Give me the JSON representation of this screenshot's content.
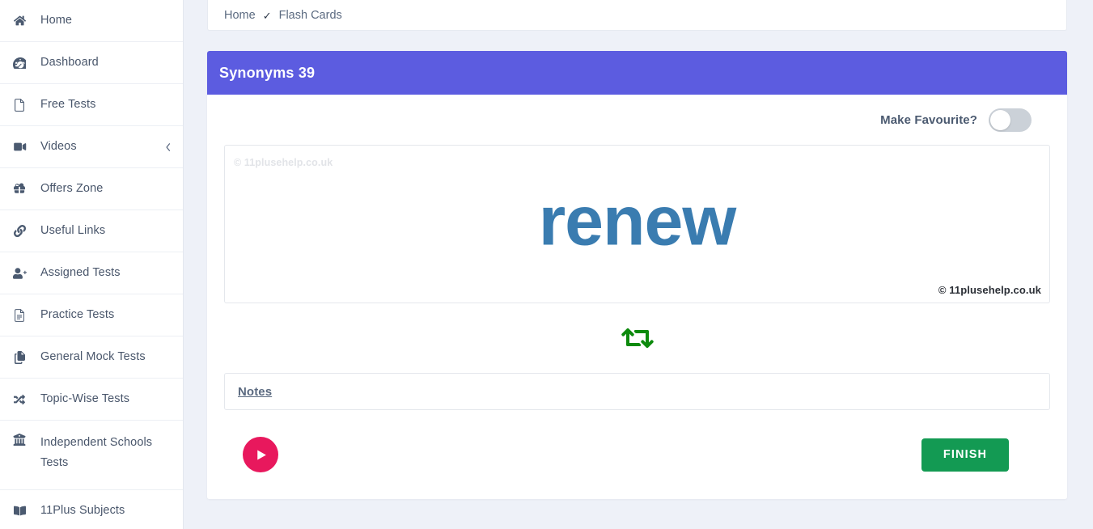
{
  "sidebar": {
    "items": [
      {
        "label": "Home",
        "icon": "home-icon",
        "has_chevron": false
      },
      {
        "label": "Dashboard",
        "icon": "dashboard-icon",
        "has_chevron": false
      },
      {
        "label": "Free Tests",
        "icon": "file-icon",
        "has_chevron": false
      },
      {
        "label": "Videos",
        "icon": "video-camera-icon",
        "has_chevron": true
      },
      {
        "label": "Offers Zone",
        "icon": "gift-icon",
        "has_chevron": false
      },
      {
        "label": "Useful Links",
        "icon": "link-icon",
        "has_chevron": false
      },
      {
        "label": "Assigned Tests",
        "icon": "user-plus-icon",
        "has_chevron": false
      },
      {
        "label": "Practice Tests",
        "icon": "document-lines-icon",
        "has_chevron": false
      },
      {
        "label": "General Mock Tests",
        "icon": "copy-files-icon",
        "has_chevron": false
      },
      {
        "label": "Topic-Wise Tests",
        "icon": "shuffle-icon",
        "has_chevron": false
      },
      {
        "label": "Independent Schools Tests",
        "icon": "bank-icon",
        "has_chevron": false
      },
      {
        "label": "11Plus Subjects",
        "icon": "book-icon",
        "has_chevron": false
      }
    ],
    "chevron_icon": "chevron-left-icon"
  },
  "breadcrumb": {
    "home_label": "Home",
    "separator": "✓",
    "current_label": "Flash Cards"
  },
  "panel": {
    "title": "Synonyms 39",
    "header_color": "#5c5ce0"
  },
  "favourite": {
    "label": "Make Favourite?",
    "toggle_state": "off",
    "toggle_track_color": "#cbd1d8"
  },
  "flashcard": {
    "watermark_top": "© 11plusehelp.co.uk",
    "watermark_bottom": "© 11plusehelp.co.uk",
    "word": "renew",
    "word_color": "#3a7cb0"
  },
  "flip": {
    "icon": "retweet-flip-icon",
    "color": "#0d8a0d"
  },
  "notes": {
    "label": "Notes"
  },
  "actions": {
    "play_icon": "play-circle-icon",
    "play_color": "#e8185d",
    "finish_label": "FINISH",
    "finish_color": "#139a53"
  }
}
